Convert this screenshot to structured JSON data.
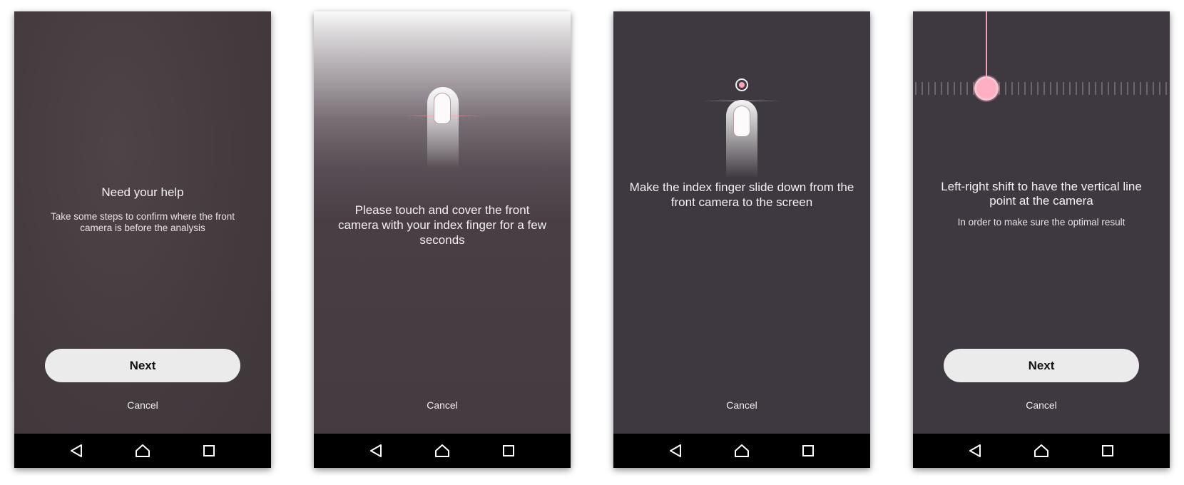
{
  "screens": [
    {
      "title": "Need your help",
      "subtitle": "Take some steps to confirm where the front camera is before the analysis",
      "next_label": "Next",
      "cancel_label": "Cancel"
    },
    {
      "instruction": "Please touch and cover the front camera with your index finger for a few seconds",
      "cancel_label": "Cancel"
    },
    {
      "instruction": "Make the index finger slide down from the front camera to the screen",
      "cancel_label": "Cancel"
    },
    {
      "title": "Left-right shift to have the vertical line point at the camera",
      "subtitle": "In order to make sure the optimal result",
      "next_label": "Next",
      "cancel_label": "Cancel"
    }
  ],
  "navbar": {
    "icons": [
      "back-triangle-icon",
      "home-icon",
      "recents-square-icon"
    ]
  },
  "colors": {
    "accent_pink": "#ffafc1",
    "screen_bg": "#3e3840",
    "button_bg": "#ebebeb",
    "navbar_bg": "#000000"
  }
}
